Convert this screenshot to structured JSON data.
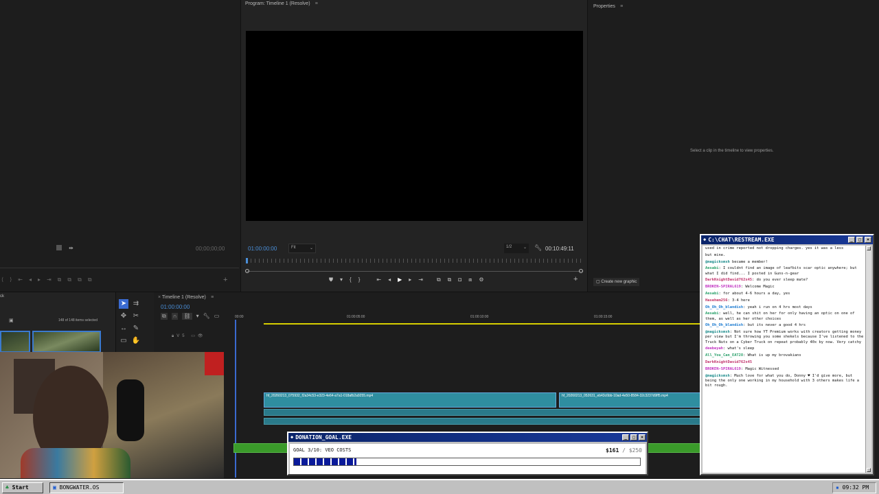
{
  "program": {
    "title": "Program: Timeline 1 (Resolve)",
    "timecode": "01:00:00:00",
    "fit": "Fit",
    "resolution": "1/2",
    "duration": "00:10:49:11"
  },
  "source": {
    "timecode": "00;00;00;00"
  },
  "properties": {
    "title": "Properties",
    "hint": "Select a clip in the timeline to view properties.",
    "create_graphic": "Create new graphic"
  },
  "project": {
    "selection": "148 of 148 items selected",
    "label": "ck"
  },
  "timeline": {
    "title": "Timeline 1 (Resolve)",
    "timecode": "01:00:00:00",
    "ruler": [
      "00:00",
      "01:00:05:00",
      "01:00:10:00",
      "01:00:15:00"
    ],
    "clip1": "hf_20260213_075932_f2a34c53-e323-4e64-a7a1-018afb2a9255.mp4",
    "clip2": "hf_20260213_052631_eb43c6bb-10ad-4e50-8584-32c3237d9ff5.mp4"
  },
  "chat": {
    "title": "C:\\CHAT\\RESTREAM.EXE",
    "messages": [
      {
        "user": "",
        "text": "used in crime reported not dropping charges. yes it was a less",
        "color": "#111111"
      },
      {
        "user": "",
        "text": "but mine.",
        "color": "#111111"
      },
      {
        "user": "@magicksmsh",
        "text": " became a member!",
        "color": "#1a8a8a"
      },
      {
        "user": "Aesabi",
        "text": ": I couldnt find an image of leafbits scar optic anywhere; but what I did find... I posted in Guns-n-gear",
        "color": "#2aa06a"
      },
      {
        "user": "DarkKnightDavid762x45",
        "text": ": do you ever sleep mate?",
        "color": "#c0306a"
      },
      {
        "user": "BROKEN-SPIRAL619",
        "text": ": Welcome Magic",
        "color": "#c030c0"
      },
      {
        "user": "Aesabi",
        "text": ": for about 4-6 hours a day, yes",
        "color": "#2aa06a"
      },
      {
        "user": "Hasehem256",
        "text": ": 3-4 here",
        "color": "#c03060"
      },
      {
        "user": "Oh_Oh_Oh_blandish",
        "text": ": yeah i run on 4 hrs most days",
        "color": "#1a7ad0"
      },
      {
        "user": "Aesabi",
        "text": ": well, he can shit on her for only having an optic on one of them, as well as her other choices",
        "color": "#2aa06a"
      },
      {
        "user": "Oh_Oh_Oh_blandish",
        "text": ": but its never a good 4 hrs",
        "color": "#1a7ad0"
      },
      {
        "user": "@magicksmsh",
        "text": ": Not sure how YT Premium works with creators getting money per view but I'm throwing you some shekels because I've listened to the Truck Nuts on a Cyber Truck on repeat probably 40x by now. Very catchy",
        "color": "#1a8a8a"
      },
      {
        "user": "deebeyah",
        "text": ": what's sleep",
        "color": "#c030c0"
      },
      {
        "user": "All_You_Can_EAT28",
        "text": ": What is up my brovakians",
        "color": "#2aa06a"
      },
      {
        "user": "DarkKnightDavid762x45",
        "text": "",
        "color": "#c0306a"
      },
      {
        "user": "BROKEN-SPIRAL619",
        "text": ": Magic Witnessed",
        "color": "#c030c0"
      },
      {
        "user": "@magicksmsh",
        "text": ": Much love for what you do, Donny ♥ I'd give more, but being the only one working in my household with 3 others makes life a bit rough.",
        "color": "#1a8a8a"
      }
    ]
  },
  "donation": {
    "title": "DONATION_GOAL.EXE",
    "goal_label": "GOAL 3/10: VEO COSTS",
    "current": "$161",
    "target": "/ $250",
    "progress": 0.18
  },
  "taskbar": {
    "start": "Start",
    "app": "BONGWATER.OS",
    "clock": "09:32 PM"
  }
}
